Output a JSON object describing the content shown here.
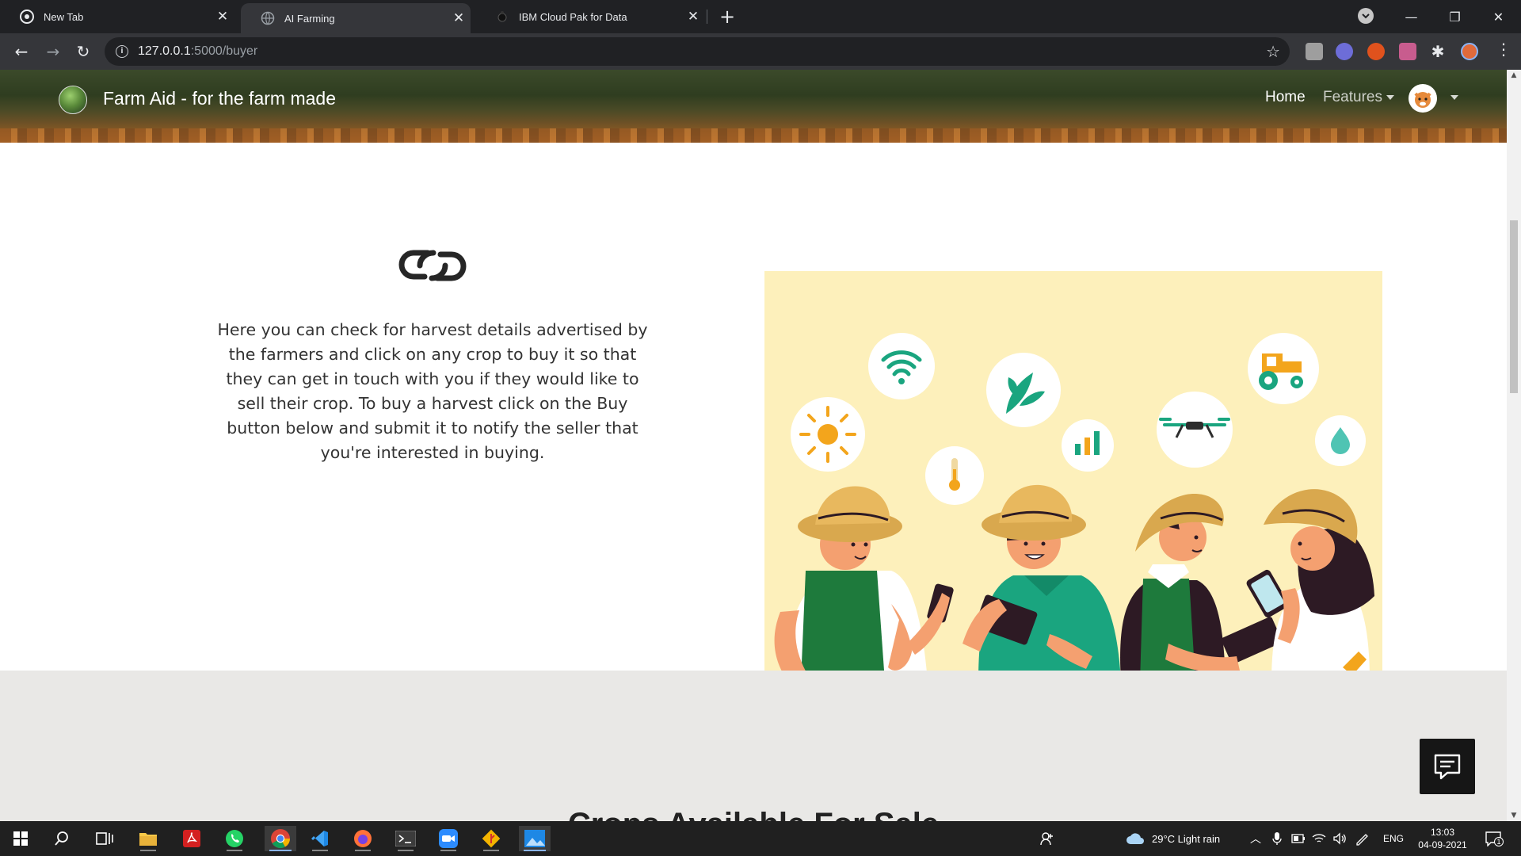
{
  "browser": {
    "tabs": [
      {
        "title": "New Tab",
        "active": false
      },
      {
        "title": "AI Farming",
        "active": true
      },
      {
        "title": "IBM Cloud Pak for Data",
        "active": false
      }
    ],
    "url_host": "127.0.0.1",
    "url_path": ":5000/buyer"
  },
  "navbar": {
    "brand": "Farm Aid - for the farm made",
    "home_label": "Home",
    "features_label": "Features"
  },
  "hero": {
    "description": "Here you can check for harvest details advertised by the farmers and click on any crop to buy it so that they can get in touch with you if they would like to sell their crop. To buy a harvest click on the Buy button below and submit it to notify the seller that you're interested in buying."
  },
  "section2": {
    "title": "Crops Available For Sale"
  },
  "taskbar": {
    "weather": "29°C  Light rain",
    "language": "ENG",
    "time": "13:03",
    "date": "04-09-2021",
    "notification_count": "1"
  },
  "colors": {
    "illustration_bg": "#fdf0bb",
    "accent_green": "#1aa57f",
    "section2_bg": "#e9e8e6"
  }
}
